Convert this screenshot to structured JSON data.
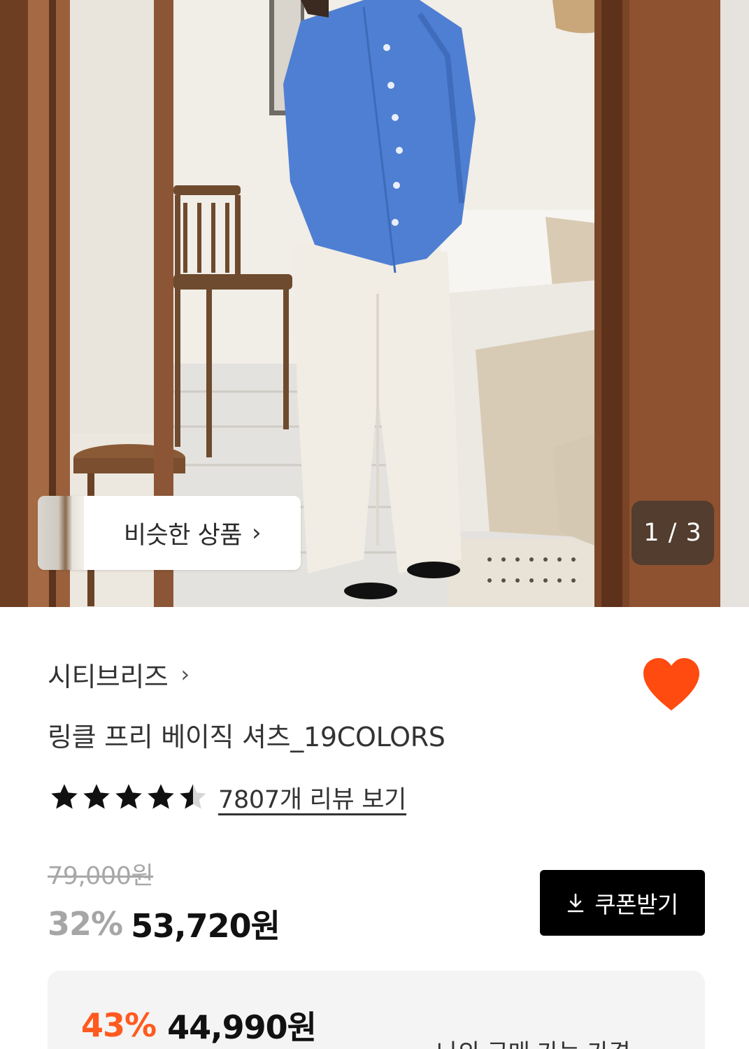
{
  "gallery": {
    "similar_label": "비슷한 상품",
    "similar_chevron": "›",
    "counter": "1 / 3"
  },
  "product": {
    "brand": "시티브리즈",
    "brand_chevron": "›",
    "name": "링클 프리 베이직 셔츠_19COLORS",
    "rating": 4.5,
    "review_link": "7807개 리뷰 보기",
    "original_price": "79,000원",
    "discount_rate": "32%",
    "sale_price": "53,720원",
    "coupon_button": "쿠폰받기",
    "liked": true
  },
  "benefit": {
    "discount_rate": "43%",
    "price": "44,990원",
    "note": "나의 구매 가능 가격"
  },
  "colors": {
    "accent": "#ff5a1f",
    "heart": "#ff4a10",
    "button_bg": "#000000",
    "muted": "#a6a6a6"
  },
  "icons": {
    "heart": "heart-icon",
    "star": "star-icon",
    "download": "download-icon",
    "chevron": "chevron-right-icon"
  }
}
